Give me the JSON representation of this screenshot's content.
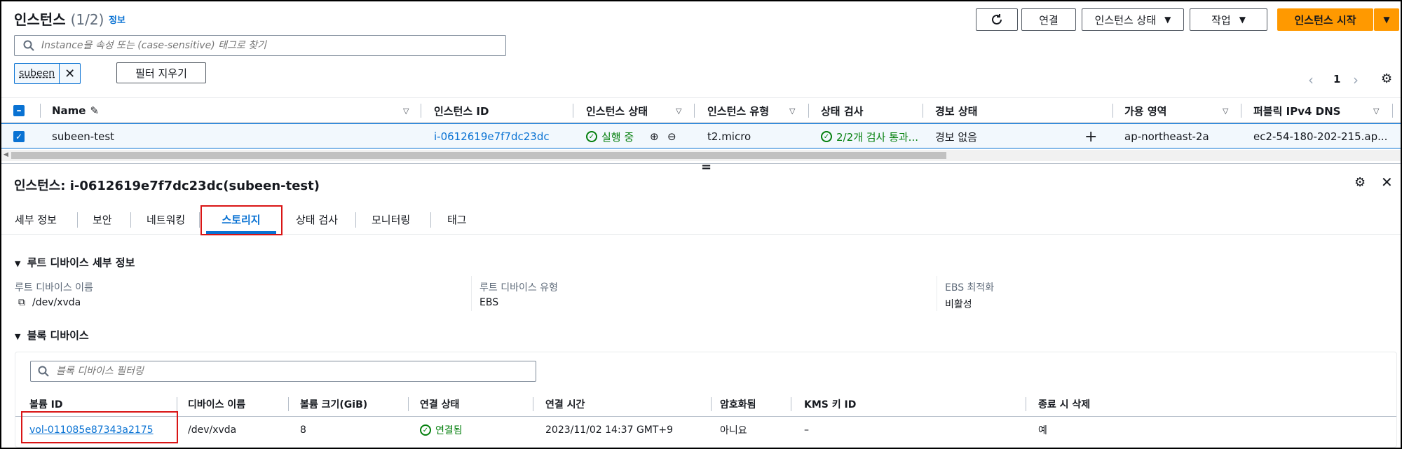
{
  "header": {
    "title": "인스턴스",
    "count": "(1/2)",
    "info_link": "정보",
    "connect_label": "연결",
    "instance_state_label": "인스턴스 상태",
    "actions_label": "작업",
    "launch_label": "인스턴스 시작"
  },
  "search": {
    "placeholder": "Instance을 속성 또는 (case-sensitive) 태그로 찾기"
  },
  "filter": {
    "token": "subeen",
    "clear_label": "필터 지우기"
  },
  "pagination": {
    "page": "1"
  },
  "table": {
    "columns": [
      "Name",
      "인스턴스 ID",
      "인스턴스 상태",
      "인스턴스 유형",
      "상태 검사",
      "경보 상태",
      "가용 영역",
      "퍼블릭 IPv4 DNS"
    ],
    "row": {
      "name": "subeen-test",
      "instance_id": "i-0612619e7f7dc23dc",
      "state": "실행 중",
      "type": "t2.micro",
      "status_check": "2/2개 검사 통과...",
      "alarm": "경보 없음",
      "az": "ap-northeast-2a",
      "dns": "ec2-54-180-202-215.ap..."
    }
  },
  "detail": {
    "title": "인스턴스: i-0612619e7f7dc23dc(subeen-test)",
    "tabs": [
      "세부 정보",
      "보안",
      "네트워킹",
      "스토리지",
      "상태 검사",
      "모니터링",
      "태그"
    ],
    "active_tab": "스토리지",
    "root_section": "루트 디바이스 세부 정보",
    "root_device_name_label": "루트 디바이스 이름",
    "root_device_name": "/dev/xvda",
    "root_device_type_label": "루트 디바이스 유형",
    "root_device_type": "EBS",
    "ebs_opt_label": "EBS 최적화",
    "ebs_opt": "비활성",
    "block_section": "블록 디바이스",
    "block_filter_placeholder": "블록 디바이스 필터링",
    "block_columns": [
      "볼륨 ID",
      "디바이스 이름",
      "볼륨 크기(GiB)",
      "연결 상태",
      "연결 시간",
      "암호화됨",
      "KMS 키 ID",
      "종료 시 삭제"
    ],
    "block_row": {
      "volume_id": "vol-011085e87343a2175",
      "device": "/dev/xvda",
      "size": "8",
      "state": "연결됨",
      "time": "2023/11/02 14:37 GMT+9",
      "encrypted": "아니요",
      "kms": "–",
      "delete_on_term": "예"
    }
  },
  "colors": {
    "accent": "#0972d3",
    "launch": "#ff9900",
    "success": "#037f0c",
    "highlight_box": "#d91515"
  }
}
